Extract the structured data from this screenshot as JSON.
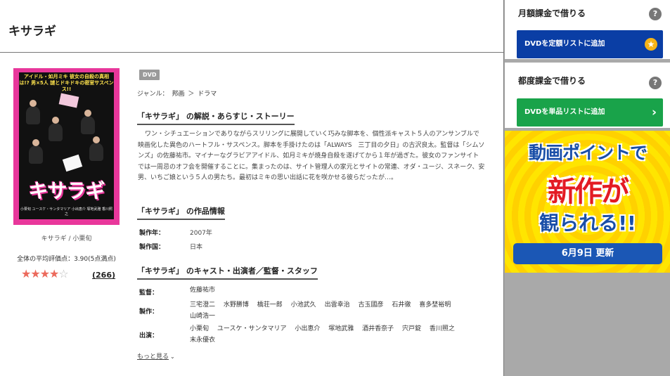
{
  "page": {
    "title": "キサラギ"
  },
  "poster": {
    "top_text": "アイドル・如月ミキ 彼女の自殺の真相は!? 男×5人 謎とドキドキの密室サスペンス!!",
    "logo_text": "キサラギ",
    "bottom_text": "小栗旬 ユースケ・サンタマリア 小出恵介 塚地武雅 香川照之"
  },
  "item": {
    "cast_short": "キサラギ / 小栗旬",
    "rating_text": "全体の平均評価点：3.90(5点満点)",
    "stars_filled": 4,
    "stars_total": 5,
    "star_glyph": "★",
    "review_count": "(266)",
    "badge": "DVD",
    "genre_label": "ジャンル：",
    "genre": [
      "邦画",
      "ドラマ"
    ],
    "genre_sep": "＞"
  },
  "synopsis": {
    "heading": "「キサラギ」 の解説・あらすじ・ストーリー",
    "text": "ワン・シチュエーションでありながらスリリングに展開していく巧みな脚本を、個性派キャスト５人のアンサンブルで映画化した異色のハートフル・サスペンス。脚本を手掛けたのは「ALWAYS　三丁目の夕日」の古沢良太。監督は「シムソンズ」の佐藤祐市。マイナーなグラビアアイドル、如月ミキが焼身自殺を遂げてから１年が過ぎた。彼女のファンサイトでは一周忌のオフ会を開催することに。集まったのは、サイト管理人の家元とサイトの常連、オダ・ユージ、スネーク、安男、いちご娘という５人の男たち。最初はミキの思い出話に花を咲かせる彼らだったが…。"
  },
  "info": {
    "heading": "「キサラギ」 の作品情報",
    "rows": [
      {
        "key": "製作年：",
        "value": "2007年"
      },
      {
        "key": "製作国：",
        "value": "日本"
      }
    ]
  },
  "staff": {
    "heading": "「キサラギ」 のキャスト・出演者／監督・スタッフ",
    "director_label": "監督：",
    "directors": [
      "佐藤祐市"
    ],
    "producer_label": "製作：",
    "producers": [
      "三宅澄二",
      "水野勝博",
      "橋荘一郎",
      "小池武久",
      "出雲幸治",
      "古玉國彦",
      "石井徹",
      "喜多埜裕明",
      "山崎浩一"
    ],
    "cast_label": "出演：",
    "cast": [
      "小栗旬",
      "ユースケ・サンタマリア",
      "小出恵介",
      "塚地武雅",
      "酒井香奈子",
      "宍戸錠",
      "香川照之",
      "末永優衣"
    ],
    "more": "もっと見る",
    "more_icon": "⌄"
  },
  "sidebar": {
    "monthly": {
      "title": "月額課金で借りる",
      "help": "?",
      "button": "DVDを定額リストに追加",
      "button_icon": "★"
    },
    "per_rental": {
      "title": "都度課金で借りる",
      "help": "?",
      "button": "DVDを単品リストに追加",
      "button_icon": "›"
    },
    "banner": {
      "line1": "動画ポイントで",
      "line2": "新作が",
      "line3": "観られる!!",
      "date": "6月9日 更新"
    }
  },
  "colors": {
    "accent_blue": "#0a3ea5",
    "accent_green": "#19a34a",
    "star_on": "#ec6a5c",
    "poster_pink": "#e8379b",
    "banner_yellow": "#ffe500"
  }
}
